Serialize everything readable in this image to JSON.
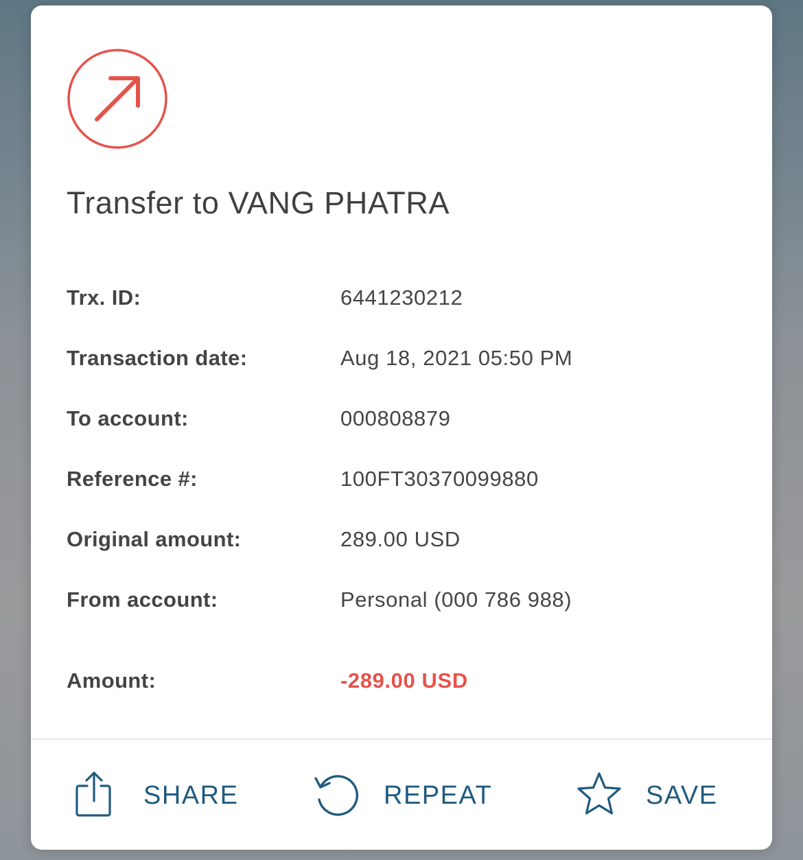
{
  "colors": {
    "accent_red": "#e5534b",
    "action_blue": "#1f5a80",
    "text_dark": "#444444"
  },
  "header": {
    "icon": "arrow-up-right-icon",
    "title": "Transfer to VANG PHATRA"
  },
  "details": [
    {
      "label": "Trx. ID:",
      "value": "6441230212"
    },
    {
      "label": "Transaction date:",
      "value": "Aug 18, 2021 05:50 PM"
    },
    {
      "label": "To account:",
      "value": "000808879"
    },
    {
      "label": "Reference #:",
      "value": "100FT30370099880"
    },
    {
      "label": "Original amount:",
      "value": "289.00 USD"
    },
    {
      "label": "From account:",
      "value": "Personal (000 786 988)"
    }
  ],
  "amount": {
    "label": "Amount:",
    "value": "-289.00 USD"
  },
  "actions": {
    "share": {
      "label": "SHARE",
      "icon": "share-icon"
    },
    "repeat": {
      "label": "REPEAT",
      "icon": "repeat-icon"
    },
    "save": {
      "label": "SAVE",
      "icon": "star-icon"
    }
  }
}
